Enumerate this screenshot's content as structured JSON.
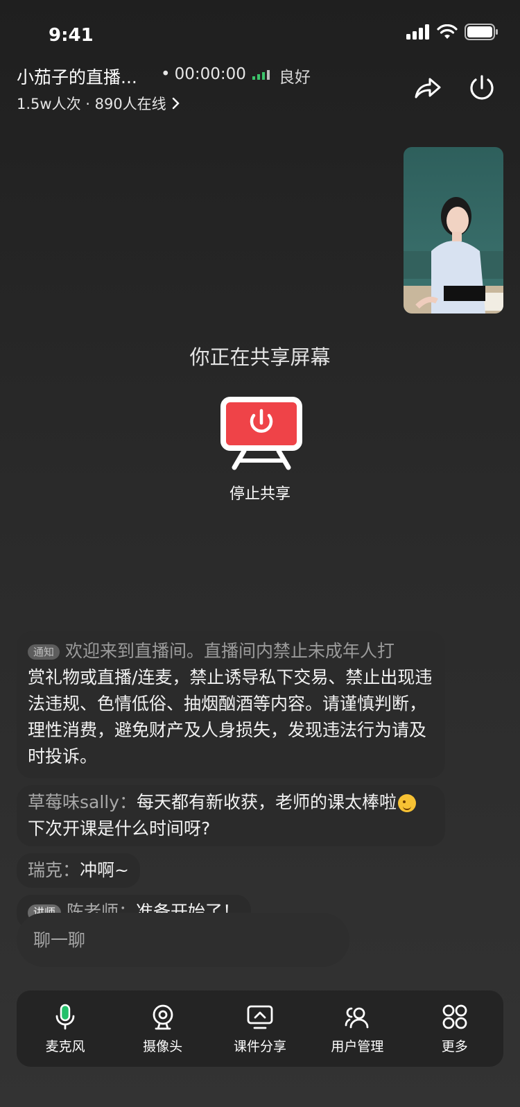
{
  "status_bar": {
    "time": "9:41"
  },
  "header": {
    "title": "小茄子的直播...",
    "timer": "00:00:00",
    "signal_text": "良好",
    "viewers": "1.5w人次 · 890人在线"
  },
  "share": {
    "status_text": "你正在共享屏幕",
    "stop_label": "停止共享"
  },
  "chat": {
    "notice_tag": "通知",
    "notice_line_partial": "欢迎来到直播间。直播间内禁止未成年人打",
    "notice_body": "赏礼物或直播/连麦，禁止诱导私下交易、禁止出现违法违规、色情低俗、抽烟酗酒等内容。请谨慎判断，理性消费，避免财产及人身损失，发现违法行为请及时投诉。",
    "messages": [
      {
        "author": "草莓味sally：",
        "text_before": "每天都有新收获，老师的课太棒啦",
        "text_after": "下次开课是什么时间呀?"
      },
      {
        "author": "瑞克：",
        "text": "冲啊~"
      },
      {
        "tag": "讲师",
        "author": "陈老师：",
        "text": "准备开始了！"
      }
    ],
    "input_placeholder": "聊一聊"
  },
  "toolbar": {
    "items": [
      {
        "label": "麦克风",
        "icon": "microphone-icon"
      },
      {
        "label": "摄像头",
        "icon": "camera-icon"
      },
      {
        "label": "课件分享",
        "icon": "screen-share-icon"
      },
      {
        "label": "用户管理",
        "icon": "users-icon"
      },
      {
        "label": "更多",
        "icon": "grid-icon"
      }
    ]
  },
  "colors": {
    "accent_red": "#ef4348",
    "signal_green": "#3cc46b",
    "mic_green": "#24c06a"
  }
}
